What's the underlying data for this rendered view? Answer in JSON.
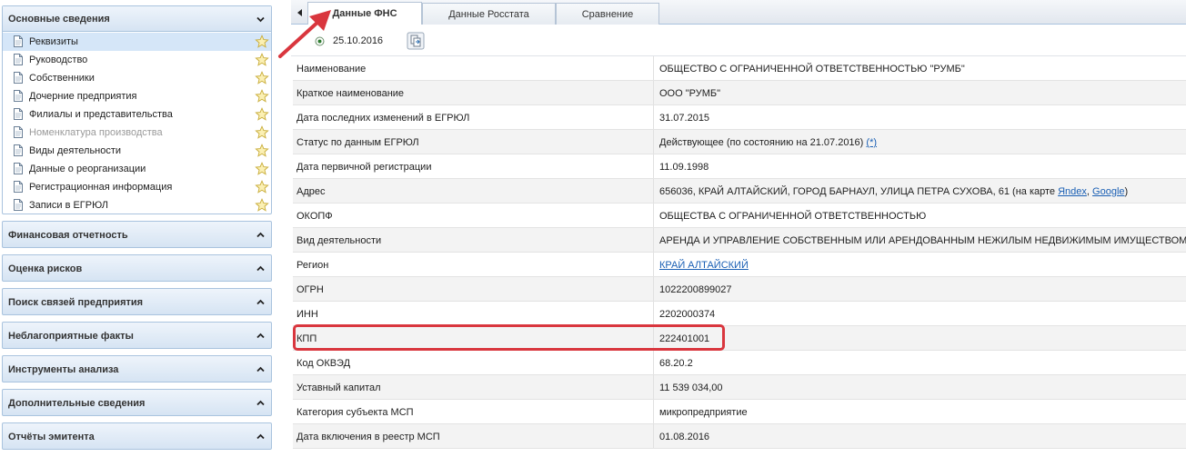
{
  "sidebar": {
    "main_section": {
      "title": "Основные сведения",
      "items": [
        {
          "label": "Реквизиты",
          "active": true,
          "disabled": false
        },
        {
          "label": "Руководство",
          "active": false,
          "disabled": false
        },
        {
          "label": "Собственники",
          "active": false,
          "disabled": false
        },
        {
          "label": "Дочерние предприятия",
          "active": false,
          "disabled": false
        },
        {
          "label": "Филиалы и представительства",
          "active": false,
          "disabled": false
        },
        {
          "label": "Номенклатура производства",
          "active": false,
          "disabled": true
        },
        {
          "label": "Виды деятельности",
          "active": false,
          "disabled": false
        },
        {
          "label": "Данные о реорганизации",
          "active": false,
          "disabled": false
        },
        {
          "label": "Регистрационная информация",
          "active": false,
          "disabled": false
        },
        {
          "label": "Записи в ЕГРЮЛ",
          "active": false,
          "disabled": false
        }
      ]
    },
    "sections": [
      {
        "title": "Финансовая отчетность"
      },
      {
        "title": "Оценка рисков"
      },
      {
        "title": "Поиск связей предприятия"
      },
      {
        "title": "Неблагоприятные факты"
      },
      {
        "title": "Инструменты анализа"
      },
      {
        "title": "Дополнительные сведения"
      },
      {
        "title": "Отчёты эмитента"
      }
    ]
  },
  "tabs": [
    {
      "label": "Данные ФНС",
      "active": true
    },
    {
      "label": "Данные Росстата",
      "active": false
    },
    {
      "label": "Сравнение",
      "active": false
    }
  ],
  "toolbar": {
    "date": "25.10.2016"
  },
  "rows": [
    {
      "label": "Наименование",
      "value": "ОБЩЕСТВО С ОГРАНИЧЕННОЙ ОТВЕТСТВЕННОСТЬЮ \"РУМБ\""
    },
    {
      "label": "Краткое наименование",
      "value": "ООО \"РУМБ\""
    },
    {
      "label": "Дата последних изменений в ЕГРЮЛ",
      "value": "31.07.2015"
    },
    {
      "label": "Статус по данным ЕГРЮЛ",
      "value": "Действующее (по состоянию на 21.07.2016)",
      "link": "(*)"
    },
    {
      "label": "Дата первичной регистрации",
      "value": "11.09.1998"
    },
    {
      "label": "Адрес",
      "value": "656036, КРАЙ АЛТАЙСКИЙ, ГОРОД БАРНАУЛ, УЛИЦА ПЕТРА СУХОВА, 61 (на карте",
      "link": "Яndex",
      "sep": ",",
      "link2": "Google",
      "suffix": ")"
    },
    {
      "label": "ОКОПФ",
      "value": "ОБЩЕСТВА С ОГРАНИЧЕННОЙ ОТВЕТСТВЕННОСТЬЮ"
    },
    {
      "label": "Вид деятельности",
      "value": "АРЕНДА И УПРАВЛЕНИЕ СОБСТВЕННЫМ ИЛИ АРЕНДОВАННЫМ НЕЖИЛЫМ НЕДВИЖИМЫМ ИМУЩЕСТВОМ"
    },
    {
      "label": "Регион",
      "value": "",
      "link": "КРАЙ АЛТАЙСКИЙ"
    },
    {
      "label": "ОГРН",
      "value": "1022200899027"
    },
    {
      "label": "ИНН",
      "value": "2202000374"
    },
    {
      "label": "КПП",
      "value": "222401001"
    },
    {
      "label": "Код ОКВЭД",
      "value": "68.20.2"
    },
    {
      "label": "Уставный капитал",
      "value": "11 539 034,00"
    },
    {
      "label": "Категория субъекта МСП",
      "value": "микропредприятие"
    },
    {
      "label": "Дата включения в реестр МСП",
      "value": "01.08.2016"
    }
  ],
  "colors": {
    "accent_blue": "#1a5fb4",
    "annotation_red": "#d9363e",
    "active_item": "#d5e6f8",
    "star": "#f2d45c"
  }
}
